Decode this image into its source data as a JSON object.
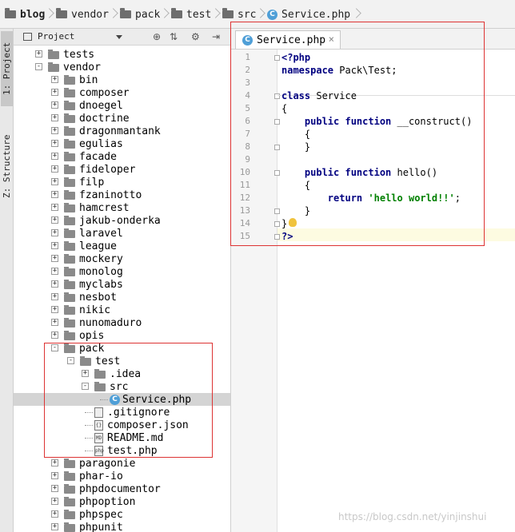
{
  "breadcrumb": [
    "blog",
    "vendor",
    "pack",
    "test",
    "src",
    "Service.php"
  ],
  "toolwindows": {
    "project_tab": "1: Project",
    "structure_tab": "Z: Structure"
  },
  "project_panel": {
    "title": "Project"
  },
  "tree": [
    {
      "label": "tests",
      "depth": 1,
      "type": "folder",
      "toggle": "+"
    },
    {
      "label": "vendor",
      "depth": 1,
      "type": "folder",
      "toggle": "-"
    },
    {
      "label": "bin",
      "depth": 2,
      "type": "folder",
      "toggle": "+"
    },
    {
      "label": "composer",
      "depth": 2,
      "type": "folder",
      "toggle": "+"
    },
    {
      "label": "dnoegel",
      "depth": 2,
      "type": "folder",
      "toggle": "+"
    },
    {
      "label": "doctrine",
      "depth": 2,
      "type": "folder",
      "toggle": "+"
    },
    {
      "label": "dragonmantank",
      "depth": 2,
      "type": "folder",
      "toggle": "+"
    },
    {
      "label": "egulias",
      "depth": 2,
      "type": "folder",
      "toggle": "+"
    },
    {
      "label": "facade",
      "depth": 2,
      "type": "folder",
      "toggle": "+"
    },
    {
      "label": "fideloper",
      "depth": 2,
      "type": "folder",
      "toggle": "+"
    },
    {
      "label": "filp",
      "depth": 2,
      "type": "folder",
      "toggle": "+"
    },
    {
      "label": "fzaninotto",
      "depth": 2,
      "type": "folder",
      "toggle": "+"
    },
    {
      "label": "hamcrest",
      "depth": 2,
      "type": "folder",
      "toggle": "+"
    },
    {
      "label": "jakub-onderka",
      "depth": 2,
      "type": "folder",
      "toggle": "+"
    },
    {
      "label": "laravel",
      "depth": 2,
      "type": "folder",
      "toggle": "+"
    },
    {
      "label": "league",
      "depth": 2,
      "type": "folder",
      "toggle": "+"
    },
    {
      "label": "mockery",
      "depth": 2,
      "type": "folder",
      "toggle": "+"
    },
    {
      "label": "monolog",
      "depth": 2,
      "type": "folder",
      "toggle": "+"
    },
    {
      "label": "myclabs",
      "depth": 2,
      "type": "folder",
      "toggle": "+"
    },
    {
      "label": "nesbot",
      "depth": 2,
      "type": "folder",
      "toggle": "+"
    },
    {
      "label": "nikic",
      "depth": 2,
      "type": "folder",
      "toggle": "+"
    },
    {
      "label": "nunomaduro",
      "depth": 2,
      "type": "folder",
      "toggle": "+"
    },
    {
      "label": "opis",
      "depth": 2,
      "type": "folder",
      "toggle": "+"
    },
    {
      "label": "pack",
      "depth": 2,
      "type": "folder",
      "toggle": "-"
    },
    {
      "label": "test",
      "depth": 3,
      "type": "folder",
      "toggle": "-"
    },
    {
      "label": ".idea",
      "depth": 4,
      "type": "folder",
      "toggle": "+"
    },
    {
      "label": "src",
      "depth": 4,
      "type": "folder",
      "toggle": "-"
    },
    {
      "label": "Service.php",
      "depth": 5,
      "type": "class",
      "selected": true
    },
    {
      "label": ".gitignore",
      "depth": 4,
      "type": "file",
      "badge": ""
    },
    {
      "label": "composer.json",
      "depth": 4,
      "type": "file",
      "badge": "{}"
    },
    {
      "label": "README.md",
      "depth": 4,
      "type": "file",
      "badge": "MD"
    },
    {
      "label": "test.php",
      "depth": 4,
      "type": "file",
      "badge": "php"
    },
    {
      "label": "paragonie",
      "depth": 2,
      "type": "folder",
      "toggle": "+"
    },
    {
      "label": "phar-io",
      "depth": 2,
      "type": "folder",
      "toggle": "+"
    },
    {
      "label": "phpdocumentor",
      "depth": 2,
      "type": "folder",
      "toggle": "+"
    },
    {
      "label": "phpoption",
      "depth": 2,
      "type": "folder",
      "toggle": "+"
    },
    {
      "label": "phpspec",
      "depth": 2,
      "type": "folder",
      "toggle": "+"
    },
    {
      "label": "phpunit",
      "depth": 2,
      "type": "folder",
      "toggle": "+"
    }
  ],
  "editor": {
    "tab_label": "Service.php",
    "tab_close": "×",
    "line_numbers": [
      "1",
      "2",
      "3",
      "4",
      "5",
      "6",
      "7",
      "8",
      "9",
      "10",
      "11",
      "12",
      "13",
      "14",
      "15"
    ],
    "lines": [
      [
        {
          "t": "<?php",
          "c": "kw"
        }
      ],
      [
        {
          "t": "namespace",
          "c": "kw"
        },
        {
          "t": " Pack\\Test;",
          "c": ""
        }
      ],
      [],
      [
        {
          "t": "class",
          "c": "kw"
        },
        {
          "t": " Service",
          "c": ""
        }
      ],
      [
        {
          "t": "{",
          "c": ""
        }
      ],
      [
        {
          "t": "    ",
          "c": ""
        },
        {
          "t": "public function",
          "c": "kw"
        },
        {
          "t": " __construct()",
          "c": ""
        }
      ],
      [
        {
          "t": "    {",
          "c": ""
        }
      ],
      [
        {
          "t": "    }",
          "c": ""
        }
      ],
      [],
      [
        {
          "t": "    ",
          "c": ""
        },
        {
          "t": "public function",
          "c": "kw"
        },
        {
          "t": " hello()",
          "c": ""
        }
      ],
      [
        {
          "t": "    {",
          "c": ""
        }
      ],
      [
        {
          "t": "        ",
          "c": ""
        },
        {
          "t": "return",
          "c": "kw"
        },
        {
          "t": " ",
          "c": ""
        },
        {
          "t": "'hello world!!'",
          "c": "str"
        },
        {
          "t": ";",
          "c": ""
        }
      ],
      [
        {
          "t": "    }",
          "c": ""
        }
      ],
      [
        {
          "t": "}",
          "c": ""
        }
      ],
      [
        {
          "t": "?>",
          "c": "kw"
        }
      ]
    ]
  },
  "watermark": "https://blog.csdn.net/yinjinshui",
  "colors": {
    "accent": "#4f9fd7",
    "highlight_box": "#dd3333",
    "keyword": "#000080",
    "string": "#008000"
  }
}
